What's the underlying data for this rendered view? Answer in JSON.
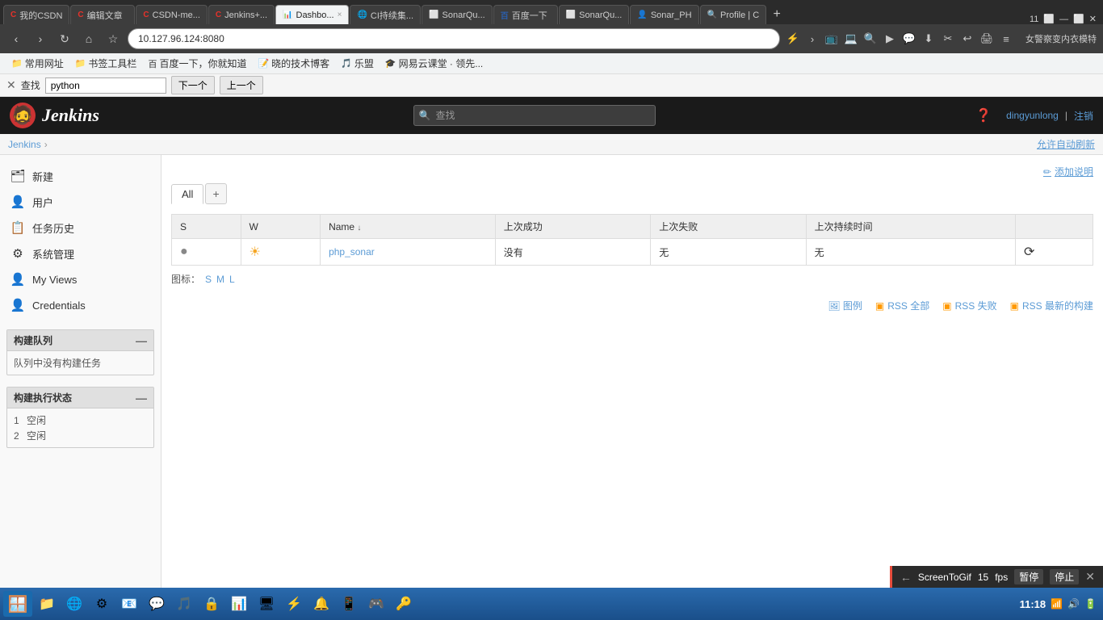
{
  "browser": {
    "tabs": [
      {
        "id": "tab1",
        "favicon": "C",
        "title": "我的CSDN",
        "active": false,
        "favicon_color": "#e8312a"
      },
      {
        "id": "tab2",
        "favicon": "C",
        "title": "编辑文章",
        "active": false,
        "favicon_color": "#e8312a"
      },
      {
        "id": "tab3",
        "favicon": "C",
        "title": "CSDN-me...",
        "active": false,
        "favicon_color": "#e8312a"
      },
      {
        "id": "tab4",
        "favicon": "J",
        "title": "Jenkins+...",
        "active": false,
        "favicon_color": "#e8312a"
      },
      {
        "id": "tab5",
        "favicon": "📊",
        "title": "Dashbo... ×",
        "active": true,
        "favicon_color": "#f39c12"
      },
      {
        "id": "tab6",
        "favicon": "🌐",
        "title": "CI持续集...",
        "active": false,
        "favicon_color": "#4a90d9"
      },
      {
        "id": "tab7",
        "favicon": "S",
        "title": "SonarQu...",
        "active": false,
        "favicon_color": "#666"
      },
      {
        "id": "tab8",
        "favicon": "百",
        "title": "百度一下",
        "active": false,
        "favicon_color": "#2b5fad"
      },
      {
        "id": "tab9",
        "favicon": "S",
        "title": "SonarQu...",
        "active": false,
        "favicon_color": "#666"
      },
      {
        "id": "tab10",
        "favicon": "👤",
        "title": "Sonar_PH",
        "active": false,
        "favicon_color": "#888"
      },
      {
        "id": "tab11",
        "favicon": "🔍",
        "title": "Profile | C",
        "active": false,
        "favicon_color": "#888"
      }
    ],
    "tab_count": "11",
    "address": "10.127.96.124:8080",
    "search_bar_text": "女警察变内衣模特"
  },
  "bookmarks": [
    {
      "label": "常用网址"
    },
    {
      "label": "书签工具栏"
    },
    {
      "label": "百度一下，你就知道"
    },
    {
      "label": "晓的技术博客"
    },
    {
      "label": "乐盟"
    },
    {
      "label": "网易云课堂 · 领先..."
    }
  ],
  "find_bar": {
    "label": "查找",
    "input_value": "python",
    "next_label": "下一个",
    "prev_label": "上一个"
  },
  "jenkins": {
    "logo_text": "Jenkins",
    "search_placeholder": "查找",
    "username": "dingyunlong",
    "logout_label": "注销",
    "breadcrumb": "Jenkins",
    "auto_refresh": "允许自动刷新",
    "add_description": "添加说明",
    "sidebar": {
      "items": [
        {
          "label": "新建",
          "icon": "🗂"
        },
        {
          "label": "用户",
          "icon": "👤"
        },
        {
          "label": "任务历史",
          "icon": "📋"
        },
        {
          "label": "系统管理",
          "icon": "⚙"
        },
        {
          "label": "My Views",
          "icon": "👤"
        },
        {
          "label": "Credentials",
          "icon": "👤"
        }
      ],
      "build_queue": {
        "title": "构建队列",
        "empty_text": "队列中没有构建任务"
      },
      "build_executor": {
        "title": "构建执行状态",
        "items": [
          {
            "num": "1",
            "status": "空闲"
          },
          {
            "num": "2",
            "status": "空闲"
          }
        ]
      }
    },
    "views": {
      "tabs": [
        {
          "label": "All",
          "active": true
        },
        {
          "label": "+",
          "is_add": true
        }
      ]
    },
    "table": {
      "headers": [
        {
          "label": "S",
          "key": "s"
        },
        {
          "label": "W",
          "key": "w"
        },
        {
          "label": "Name",
          "key": "name",
          "sortable": true,
          "sort_arrow": "↓"
        },
        {
          "label": "上次成功",
          "key": "last_success"
        },
        {
          "label": "上次失败",
          "key": "last_fail"
        },
        {
          "label": "上次持续时间",
          "key": "last_duration"
        }
      ],
      "rows": [
        {
          "s": "●",
          "w": "☀",
          "name": "php_sonar",
          "last_success": "没有",
          "last_fail": "无",
          "last_duration": "无"
        }
      ]
    },
    "icon_legend": {
      "label": "图标：",
      "sizes": [
        "S",
        "M",
        "L"
      ]
    },
    "rss_links": [
      {
        "label": "图例"
      },
      {
        "label": "RSS 全部"
      },
      {
        "label": "RSS 失败"
      },
      {
        "label": "RSS 最新的构建"
      }
    ]
  },
  "screentogif": {
    "title": "ScreenToGif",
    "fps_label": "fps",
    "fps_value": "15",
    "pause_label": "暂停",
    "stop_label": "停止"
  },
  "taskbar": {
    "time": "11:18"
  }
}
